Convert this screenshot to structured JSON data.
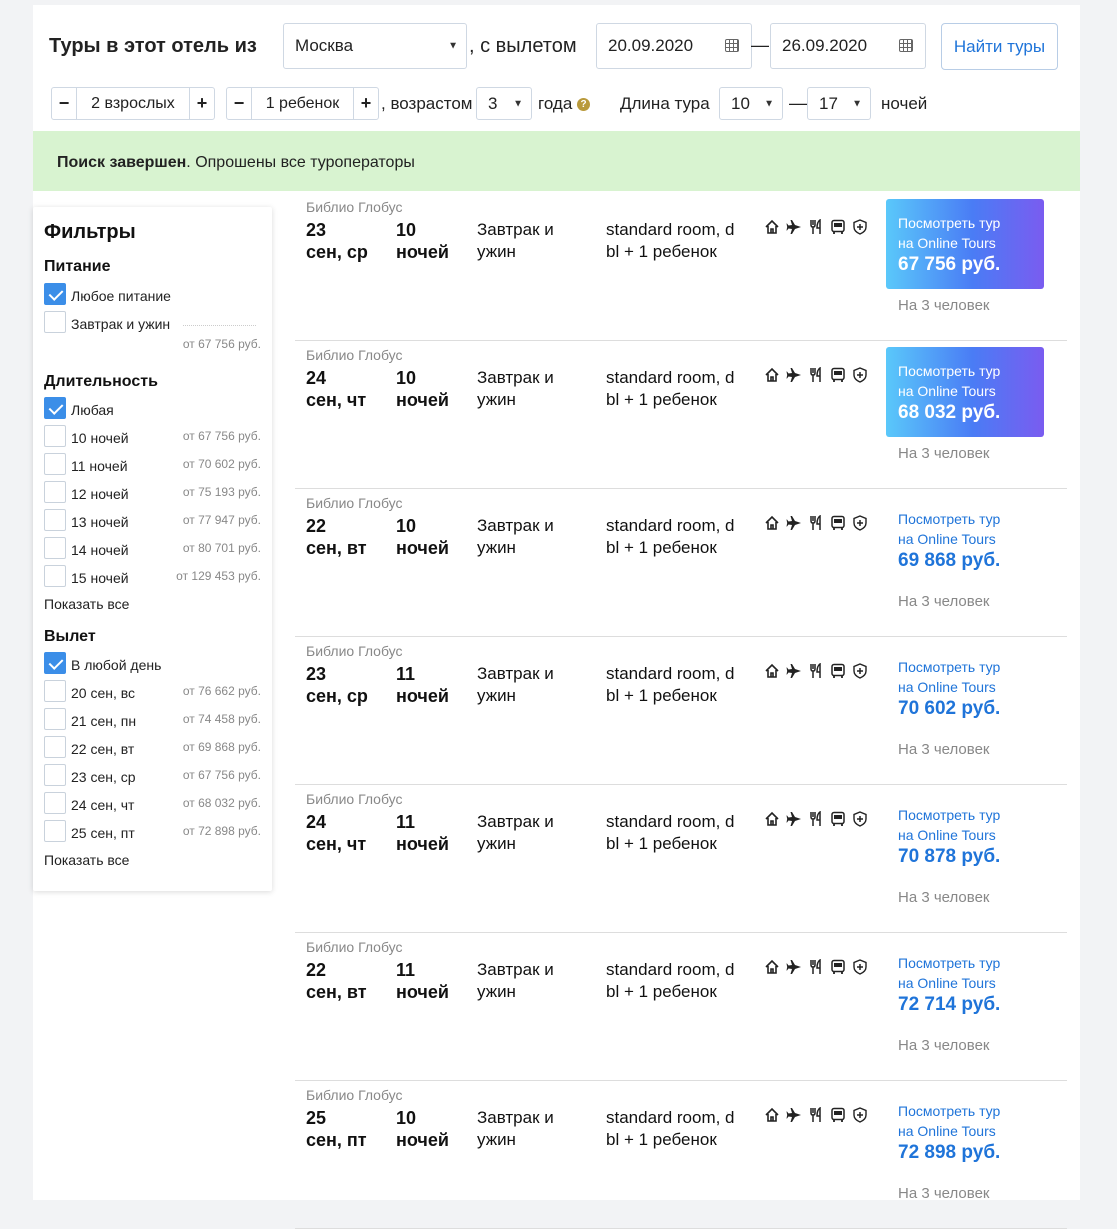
{
  "search": {
    "title": "Туры в этот отель из",
    "city": "Москва",
    "departure_label": ", с вылетом",
    "date_from": "20.09.2020",
    "date_dash": "—",
    "date_to": "26.09.2020",
    "find_button": "Найти туры",
    "adults": "2 взрослых",
    "children": "1 ребенок",
    "age_label": ", возрастом",
    "age_value": "3",
    "age_unit": "года",
    "duration_label": "Длина тура",
    "nights_from": "10",
    "nights_dash": "—",
    "nights_to": "17",
    "nights_unit": "ночей",
    "minus": "−",
    "plus": "+"
  },
  "status": {
    "bold": "Поиск завершен",
    "rest": ". Опрошены все туроператоры"
  },
  "filters": {
    "title": "Фильтры",
    "meal": {
      "title": "Питание",
      "items": [
        {
          "label": "Любое питание",
          "checked": true,
          "price": ""
        },
        {
          "label": "Завтрак и ужин",
          "checked": false,
          "price": "от 67 756 руб."
        }
      ]
    },
    "duration": {
      "title": "Длительность",
      "items": [
        {
          "label": "Любая",
          "checked": true,
          "price": ""
        },
        {
          "label": "10 ночей",
          "checked": false,
          "price": "от 67 756 руб."
        },
        {
          "label": "11 ночей",
          "checked": false,
          "price": "от 70 602 руб."
        },
        {
          "label": "12 ночей",
          "checked": false,
          "price": "от 75 193 руб."
        },
        {
          "label": "13 ночей",
          "checked": false,
          "price": "от 77 947 руб."
        },
        {
          "label": "14 ночей",
          "checked": false,
          "price": "от 80 701 руб."
        },
        {
          "label": "15 ночей",
          "checked": false,
          "price": "от 129 453 руб."
        }
      ],
      "show_all": "Показать все"
    },
    "departure": {
      "title": "Вылет",
      "items": [
        {
          "label": "В любой день",
          "checked": true,
          "price": ""
        },
        {
          "label": "20 сен, вс",
          "checked": false,
          "price": "от 76 662 руб."
        },
        {
          "label": "21 сен, пн",
          "checked": false,
          "price": "от 74 458 руб."
        },
        {
          "label": "22 сен, вт",
          "checked": false,
          "price": "от 69 868 руб."
        },
        {
          "label": "23 сен, ср",
          "checked": false,
          "price": "от 67 756 руб."
        },
        {
          "label": "24 сен, чт",
          "checked": false,
          "price": "от 68 032 руб."
        },
        {
          "label": "25 сен, пт",
          "checked": false,
          "price": "от 72 898 руб."
        }
      ],
      "show_all": "Показать все"
    }
  },
  "tours": [
    {
      "operator": "Библио Глобус",
      "day": "23",
      "weekday": "сен, ср",
      "nights": "10",
      "nights_unit": "ночей",
      "meal_1": "Завтрак и",
      "meal_2": "ужин",
      "room_1": "standard room, d",
      "room_2": "bl + 1 ребенок",
      "cta_1": "Посмотреть тур",
      "cta_2": "на Online Tours",
      "price": "67 756 руб.",
      "people": "На 3 человек",
      "highlight": true
    },
    {
      "operator": "Библио Глобус",
      "day": "24",
      "weekday": "сен, чт",
      "nights": "10",
      "nights_unit": "ночей",
      "meal_1": "Завтрак и",
      "meal_2": "ужин",
      "room_1": "standard room, d",
      "room_2": "bl + 1 ребенок",
      "cta_1": "Посмотреть тур",
      "cta_2": "на Online Tours",
      "price": "68 032 руб.",
      "people": "На 3 человек",
      "highlight": true
    },
    {
      "operator": "Библио Глобус",
      "day": "22",
      "weekday": "сен, вт",
      "nights": "10",
      "nights_unit": "ночей",
      "meal_1": "Завтрак и",
      "meal_2": "ужин",
      "room_1": "standard room, d",
      "room_2": "bl + 1 ребенок",
      "cta_1": "Посмотреть тур",
      "cta_2": "на Online Tours",
      "price": "69 868 руб.",
      "people": "На 3 человек",
      "highlight": false
    },
    {
      "operator": "Библио Глобус",
      "day": "23",
      "weekday": "сен, ср",
      "nights": "11",
      "nights_unit": "ночей",
      "meal_1": "Завтрак и",
      "meal_2": "ужин",
      "room_1": "standard room, d",
      "room_2": "bl + 1 ребенок",
      "cta_1": "Посмотреть тур",
      "cta_2": "на Online Tours",
      "price": "70 602 руб.",
      "people": "На 3 человек",
      "highlight": false
    },
    {
      "operator": "Библио Глобус",
      "day": "24",
      "weekday": "сен, чт",
      "nights": "11",
      "nights_unit": "ночей",
      "meal_1": "Завтрак и",
      "meal_2": "ужин",
      "room_1": "standard room, d",
      "room_2": "bl + 1 ребенок",
      "cta_1": "Посмотреть тур",
      "cta_2": "на Online Tours",
      "price": "70 878 руб.",
      "people": "На 3 человек",
      "highlight": false
    },
    {
      "operator": "Библио Глобус",
      "day": "22",
      "weekday": "сен, вт",
      "nights": "11",
      "nights_unit": "ночей",
      "meal_1": "Завтрак и",
      "meal_2": "ужин",
      "room_1": "standard room, d",
      "room_2": "bl + 1 ребенок",
      "cta_1": "Посмотреть тур",
      "cta_2": "на Online Tours",
      "price": "72 714 руб.",
      "people": "На 3 человек",
      "highlight": false
    },
    {
      "operator": "Библио Глобус",
      "day": "25",
      "weekday": "сен, пт",
      "nights": "10",
      "nights_unit": "ночей",
      "meal_1": "Завтрак и",
      "meal_2": "ужин",
      "room_1": "standard room, d",
      "room_2": "bl + 1 ребенок",
      "cta_1": "Посмотреть тур",
      "cta_2": "на Online Tours",
      "price": "72 898 руб.",
      "people": "На 3 человек",
      "highlight": false
    }
  ],
  "tour_icons": [
    "hotel-icon",
    "flight-icon",
    "meal-icon",
    "transfer-bus-icon",
    "insurance-shield-icon"
  ],
  "colors": {
    "accent": "#1f74d9",
    "banner": "#d8f3d0",
    "checkbox": "#3b8ee8"
  }
}
